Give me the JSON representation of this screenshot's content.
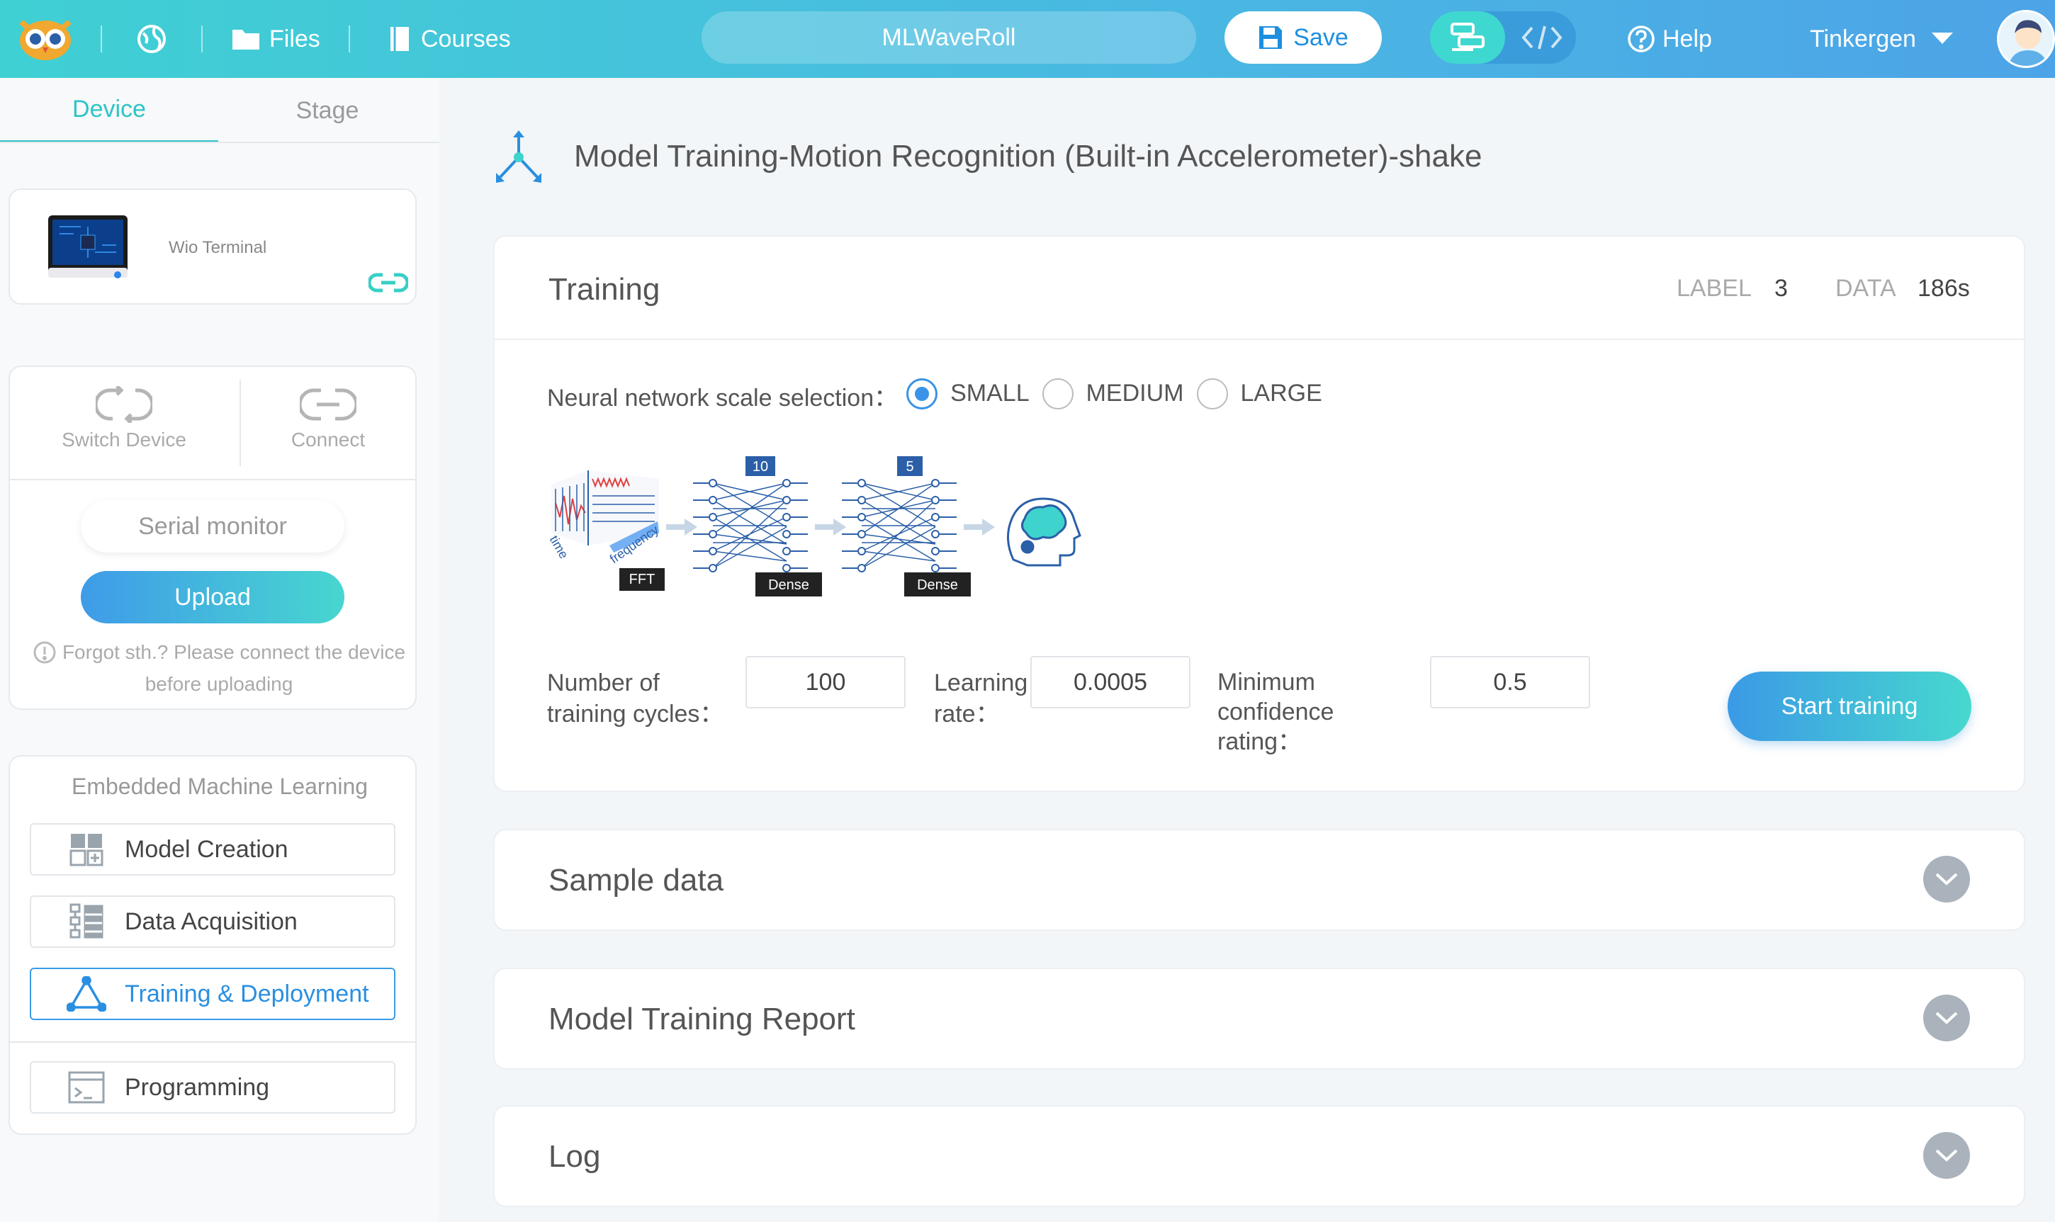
{
  "topbar": {
    "files": "Files",
    "courses": "Courses",
    "project_name": "MLWaveRoll",
    "save": "Save",
    "help": "Help",
    "user": "Tinkergen"
  },
  "sidebar": {
    "tabs": [
      "Device",
      "Stage"
    ],
    "device_name": "Wio Terminal",
    "switch_device": "Switch Device",
    "connect": "Connect",
    "serial_monitor": "Serial monitor",
    "upload": "Upload",
    "hint_line1": "Forgot sth.? Please connect the device",
    "hint_line2": "before uploading",
    "ml_title": "Embedded Machine Learning",
    "ml_items": [
      "Model Creation",
      "Data Acquisition",
      "Training & Deployment",
      "Programming"
    ]
  },
  "main": {
    "title": "Model Training-Motion Recognition (Built-in Accelerometer)-shake",
    "training": {
      "title": "Training",
      "label_key": "LABEL",
      "label_value": "3",
      "data_key": "DATA",
      "data_value": "186s",
      "scale_label": "Neural network scale selection：",
      "scale_options": [
        "SMALL",
        "MEDIUM",
        "LARGE"
      ],
      "scale_selected": "SMALL",
      "diagram": {
        "time": "time",
        "frequency": "frequency",
        "fft": "FFT",
        "layer1_units": "10",
        "layer2_units": "5",
        "dense": "Dense"
      },
      "cycles_label_1": "Number of",
      "cycles_label_2": "training cycles：",
      "cycles_value": "100",
      "lr_label_1": "Learning",
      "lr_label_2": "rate：",
      "lr_value": "0.0005",
      "conf_label_1": "Minimum",
      "conf_label_2": "confidence",
      "conf_label_3": "rating：",
      "conf_value": "0.5",
      "start": "Start training"
    },
    "sections": [
      "Sample data",
      "Model Training Report",
      "Log"
    ]
  }
}
